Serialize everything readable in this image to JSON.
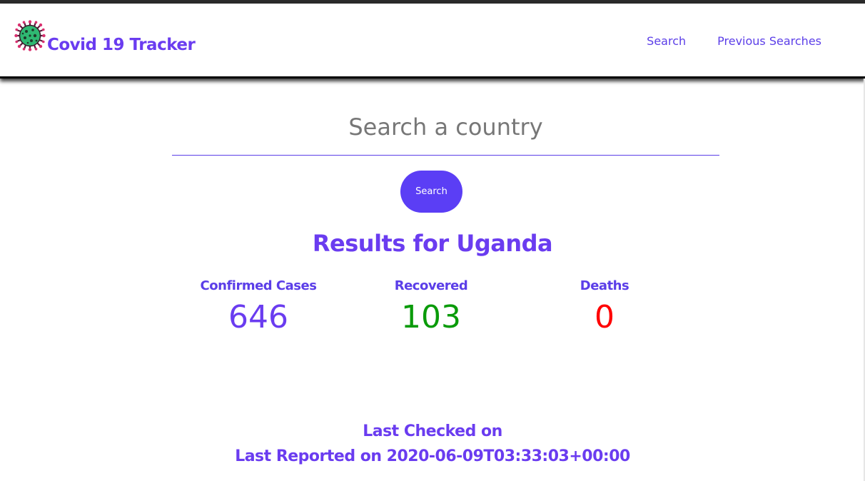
{
  "brand": {
    "title": "Covid 19 Tracker",
    "icon": "virus-icon"
  },
  "nav": {
    "items": [
      {
        "label": "Search"
      },
      {
        "label": "Previous Searches"
      }
    ]
  },
  "search": {
    "placeholder": "Search a country",
    "value": "",
    "button_label": "Search"
  },
  "results": {
    "title": "Results for Uganda",
    "stats": [
      {
        "label": "Confirmed Cases",
        "value": "646",
        "color": "#6a3cf0"
      },
      {
        "label": "Recovered",
        "value": "103",
        "color": "#0a9b0a"
      },
      {
        "label": "Deaths",
        "value": "0",
        "color": "#ff0000"
      }
    ]
  },
  "footer": {
    "last_checked": "Last Checked on",
    "last_reported": "Last Reported on 2020-06-09T03:33:03+00:00"
  },
  "colors": {
    "accent": "#6a3cf0",
    "button": "#5b3ef5",
    "recovered": "#0a9b0a",
    "deaths": "#ff0000"
  }
}
